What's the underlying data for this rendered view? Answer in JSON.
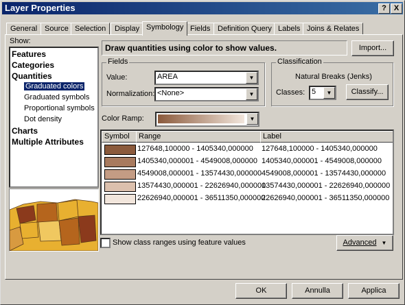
{
  "window": {
    "title": "Layer Properties",
    "help_btn": "?",
    "close_btn": "X"
  },
  "tabs": [
    "General",
    "Source",
    "Selection",
    "Display",
    "Symbology",
    "Fields",
    "Definition Query",
    "Labels",
    "Joins & Relates"
  ],
  "show": {
    "label": "Show:",
    "items": [
      {
        "text": "Features",
        "bold": true,
        "indent": 0
      },
      {
        "text": "Categories",
        "bold": true,
        "indent": 0
      },
      {
        "text": "Quantities",
        "bold": true,
        "indent": 0
      },
      {
        "text": "Graduated colors",
        "bold": false,
        "indent": 1,
        "selected": true
      },
      {
        "text": "Graduated symbols",
        "bold": false,
        "indent": 1
      },
      {
        "text": "Proportional symbols",
        "bold": false,
        "indent": 1
      },
      {
        "text": "Dot density",
        "bold": false,
        "indent": 1
      },
      {
        "text": "Charts",
        "bold": true,
        "indent": 0
      },
      {
        "text": "Multiple Attributes",
        "bold": true,
        "indent": 0
      }
    ]
  },
  "description": "Draw quantities using color to show values.",
  "import_btn": "Import...",
  "fields": {
    "group_label": "Fields",
    "value_label": "Value:",
    "value": "AREA",
    "normalization_label": "Normalization:",
    "normalization": "<None>"
  },
  "classification": {
    "group_label": "Classification",
    "method": "Natural Breaks (Jenks)",
    "classes_label": "Classes:",
    "classes": "5",
    "classify_btn": "Classify..."
  },
  "color_ramp": {
    "label": "Color Ramp:",
    "start": "#8b5a3c",
    "end": "#f2e6dc"
  },
  "table": {
    "headers": {
      "symbol": "Symbol",
      "range": "Range",
      "label": "Label"
    },
    "rows": [
      {
        "color": "#8b5a3c",
        "range": "127648,100000 - 1405340,000000",
        "label": "127648,100000 - 1405340,000000"
      },
      {
        "color": "#a87a5e",
        "range": "1405340,000001 - 4549008,000000",
        "label": "1405340,000001 - 4549008,000000"
      },
      {
        "color": "#c49c84",
        "range": "4549008,000001 - 13574430,000000",
        "label": "4549008,000001 - 13574430,000000"
      },
      {
        "color": "#dcc0ad",
        "range": "13574430,000001 - 22626940,000000",
        "label": "13574430,000001 - 22626940,000000"
      },
      {
        "color": "#f2e6dc",
        "range": "22626940,000001 - 36511350,000000",
        "label": "22626940,000001 - 36511350,000000"
      }
    ]
  },
  "show_ranges_label": "Show class ranges using feature values",
  "advanced_btn": "Advanced",
  "buttons": {
    "ok": "OK",
    "cancel": "Annulla",
    "apply": "Applica"
  },
  "colors": {
    "titlebar": "#0a246a",
    "selection": "#0a246a",
    "map_land": "#e8b030",
    "map_dark": "#8b3a1c"
  }
}
